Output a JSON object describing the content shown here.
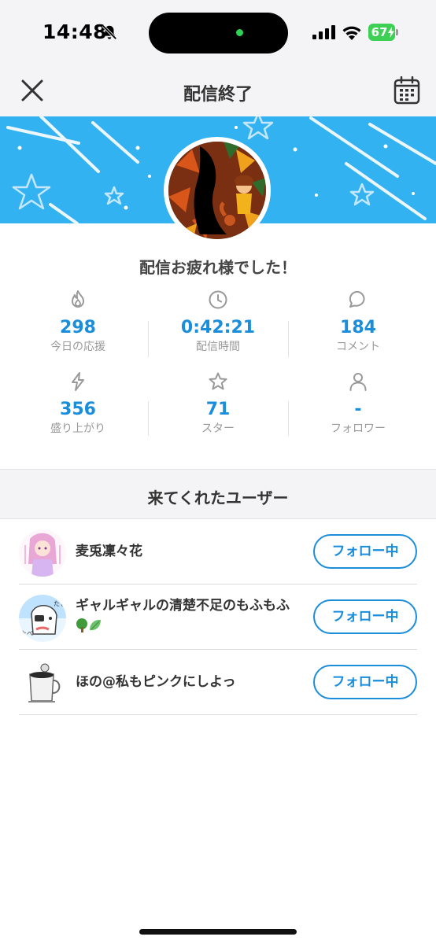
{
  "status_bar": {
    "time": "14:48",
    "battery": "67"
  },
  "nav": {
    "title": "配信終了"
  },
  "greeting": "配信お疲れ様でした！",
  "stats": [
    {
      "icon": "flame-icon",
      "value": "298",
      "label": "今日の応援"
    },
    {
      "icon": "clock-icon",
      "value": "0:42:21",
      "label": "配信時間"
    },
    {
      "icon": "comment-icon",
      "value": "184",
      "label": "コメント"
    },
    {
      "icon": "bolt-icon",
      "value": "356",
      "label": "盛り上がり"
    },
    {
      "icon": "star-icon",
      "value": "71",
      "label": "スター"
    },
    {
      "icon": "person-icon",
      "value": "-",
      "label": "フォロワー"
    }
  ],
  "visitors": {
    "title": "来てくれたユーザー",
    "users": [
      {
        "name": "麦兎凜々花",
        "button": "フォロー中"
      },
      {
        "name": "ギャルギャルの清楚不足のもふもふ",
        "button": "フォロー中"
      },
      {
        "name": "ほの@私もピンクにしよっ",
        "button": "フォロー中"
      }
    ]
  },
  "colors": {
    "accent": "#1a8ddb",
    "banner": "#33b2f2",
    "battery": "#3ecf55"
  }
}
